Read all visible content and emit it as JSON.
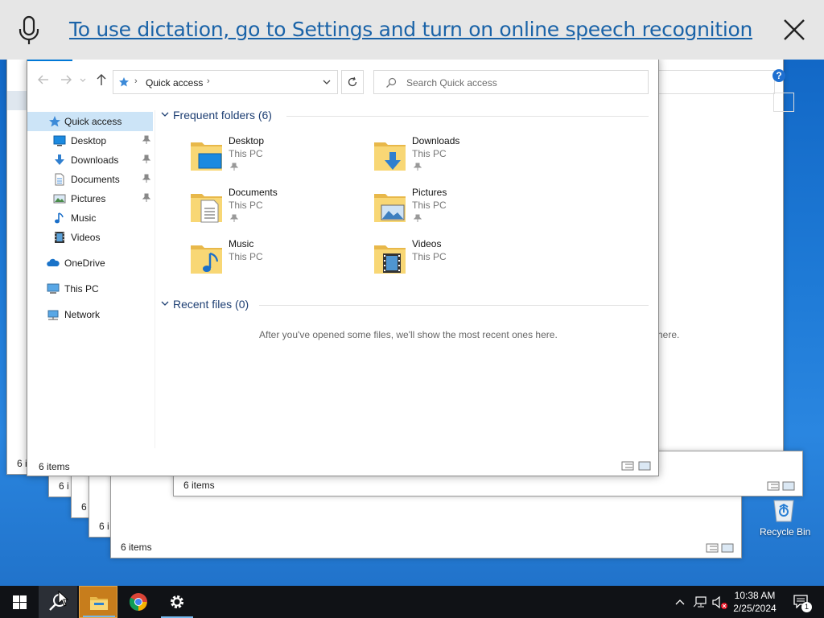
{
  "dictation": {
    "message": "To use dictation, go to Settings and turn on online speech recognition"
  },
  "background_windows": {
    "w1_status": "6 i",
    "w2_status": "6 i",
    "w3_status": "6 i",
    "w4_status": "6 i",
    "w5_status": "6 items",
    "w6_status": "6 items",
    "partial_text": "here."
  },
  "explorer": {
    "address_location": "Quick access",
    "search_placeholder": "Search Quick access",
    "sidebar": [
      {
        "label": "Quick access",
        "icon": "star-icon"
      },
      {
        "label": "Desktop",
        "icon": "desktop-icon"
      },
      {
        "label": "Downloads",
        "icon": "download-icon"
      },
      {
        "label": "Documents",
        "icon": "document-icon"
      },
      {
        "label": "Pictures",
        "icon": "pictures-icon"
      },
      {
        "label": "Music",
        "icon": "music-icon"
      },
      {
        "label": "Videos",
        "icon": "videos-icon"
      },
      {
        "label": "OneDrive",
        "icon": "cloud-icon"
      },
      {
        "label": "This PC",
        "icon": "computer-icon"
      },
      {
        "label": "Network",
        "icon": "network-icon"
      }
    ],
    "frequent_header": "Frequent folders (6)",
    "folders": [
      {
        "name": "Desktop",
        "location": "This PC"
      },
      {
        "name": "Downloads",
        "location": "This PC"
      },
      {
        "name": "Documents",
        "location": "This PC"
      },
      {
        "name": "Pictures",
        "location": "This PC"
      },
      {
        "name": "Music",
        "location": "This PC"
      },
      {
        "name": "Videos",
        "location": "This PC"
      }
    ],
    "recent_header": "Recent files (0)",
    "recent_empty": "After you've opened some files, we'll show the most recent ones here.",
    "status": "6 items"
  },
  "desktop": {
    "recycle_bin": "Recycle Bin"
  },
  "taskbar": {
    "time": "10:38 AM",
    "date": "2/25/2024",
    "notification_count": "1"
  },
  "colors": {
    "accent": "#0078d7",
    "link": "#1a63a8",
    "selection": "#cce4f7",
    "folder": "#f8d775"
  }
}
